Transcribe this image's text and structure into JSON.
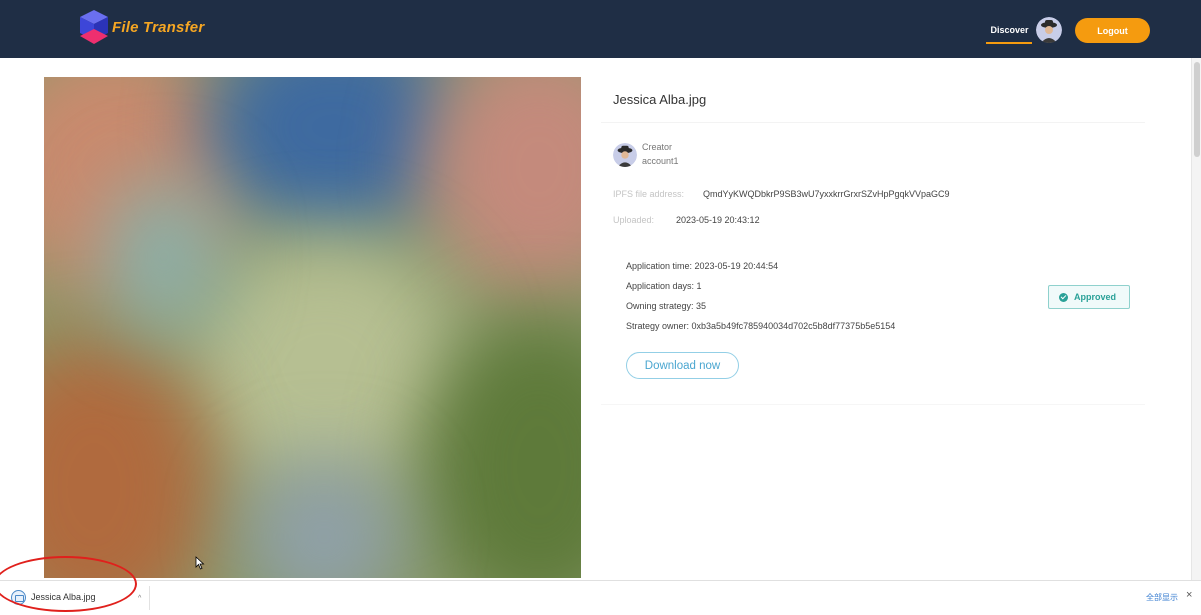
{
  "header": {
    "brand": "File Transfer",
    "nav_discover": "Discover",
    "logout_label": "Logout"
  },
  "file": {
    "title": "Jessica Alba.jpg",
    "creator_label": "Creator",
    "creator_account": "account1",
    "ipfs_label": "IPFS file address:",
    "ipfs_value": "QmdYyKWQDbkrP9SB3wU7yxxkrrGrxrSZvHpPgqkVVpaGC9",
    "uploaded_label": "Uploaded:",
    "uploaded_value": "2023-05-19 20:43:12"
  },
  "application": {
    "time": "Application time: 2023-05-19 20:44:54",
    "days": "Application days: 1",
    "strategy": "Owning strategy: 35",
    "owner": "Strategy owner: 0xb3a5b49fc785940034d702c5b8df77375b5e5154",
    "status": "Approved",
    "status_color": "#2aa198"
  },
  "download_label": "Download now",
  "download_bar": {
    "file_name": "Jessica Alba.jpg",
    "show_all": "全部显示",
    "close": "×"
  },
  "colors": {
    "header_bg": "#1f2e45",
    "accent": "#f59b0f"
  },
  "icons": {
    "logo": "cube-logo-icon",
    "file": "file-download-icon",
    "check": "check-circle-icon",
    "close": "close-icon",
    "chevron": "chevron-up-icon"
  }
}
